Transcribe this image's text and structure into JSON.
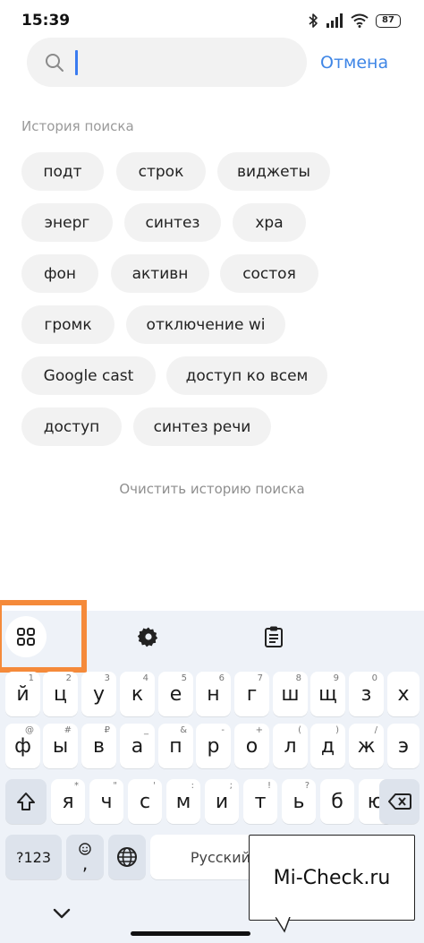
{
  "status": {
    "time": "15:39",
    "battery": "87"
  },
  "search": {
    "placeholder": "",
    "cancel_label": "Отмена"
  },
  "history": {
    "title": "История поиска",
    "chips": [
      "подт",
      "строк",
      "виджеты",
      "энерг",
      "синтез",
      "хра",
      "фон",
      "активн",
      "состоя",
      "громк",
      "отключение wi",
      "Google cast",
      "доступ ко всем",
      "доступ",
      "синтез речи"
    ],
    "clear_label": "Очистить историю поиска"
  },
  "keyboard": {
    "toolbar": [
      "apps-icon",
      "settings-icon",
      "clipboard-icon"
    ],
    "row1": [
      "й",
      "ц",
      "у",
      "к",
      "е",
      "н",
      "г",
      "ш",
      "щ",
      "з",
      "х"
    ],
    "row1_hints": [
      "1",
      "2",
      "3",
      "4",
      "5",
      "6",
      "7",
      "8",
      "9",
      "0",
      ""
    ],
    "row2": [
      "ф",
      "ы",
      "в",
      "а",
      "п",
      "р",
      "о",
      "л",
      "д",
      "ж",
      "э"
    ],
    "row2_hints": [
      "@",
      "#",
      "₽",
      "_",
      "&",
      "-",
      "+",
      "(",
      ")",
      "/",
      ""
    ],
    "row3": [
      "я",
      "ч",
      "с",
      "м",
      "и",
      "т",
      "ь",
      "б",
      "ю"
    ],
    "row3_hints": [
      "*",
      "\"",
      "'",
      ":",
      ";",
      "!",
      "?",
      "",
      ""
    ],
    "symbols_label": "?123",
    "emoji_comma_label": ",",
    "space_label": "Русский"
  },
  "watermark": {
    "text": "Mi-Check.ru"
  },
  "colors": {
    "accent": "#3f86e6",
    "chip_bg": "#f2f2f2",
    "keyboard_bg": "#eef2f8",
    "highlight": "#f58a3a"
  }
}
